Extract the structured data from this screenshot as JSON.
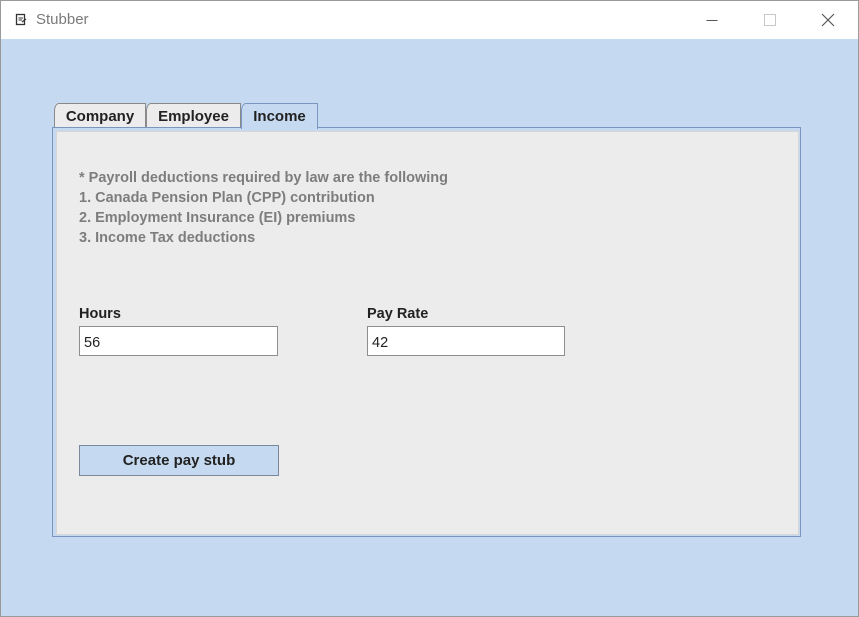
{
  "window": {
    "title": "Stubber",
    "controls": {
      "minimize": "minimize-icon",
      "maximize": "maximize-icon",
      "close": "close-icon"
    },
    "colors": {
      "background": "#c5daf0",
      "panel": "#ececec",
      "note_text": "#7d7d7d"
    }
  },
  "tabs": [
    {
      "label": "Company",
      "selected": false
    },
    {
      "label": "Employee",
      "selected": false
    },
    {
      "label": "Income",
      "selected": true
    }
  ],
  "income": {
    "notes": [
      "* Payroll deductions required by law are the following",
      "1. Canada Pension Plan (CPP) contribution",
      "2. Employment Insurance (EI) premiums",
      "3. Income Tax deductions"
    ],
    "hours": {
      "label": "Hours",
      "value": "56"
    },
    "pay_rate": {
      "label": "Pay Rate",
      "value": "42"
    },
    "create_button": "Create pay stub"
  }
}
